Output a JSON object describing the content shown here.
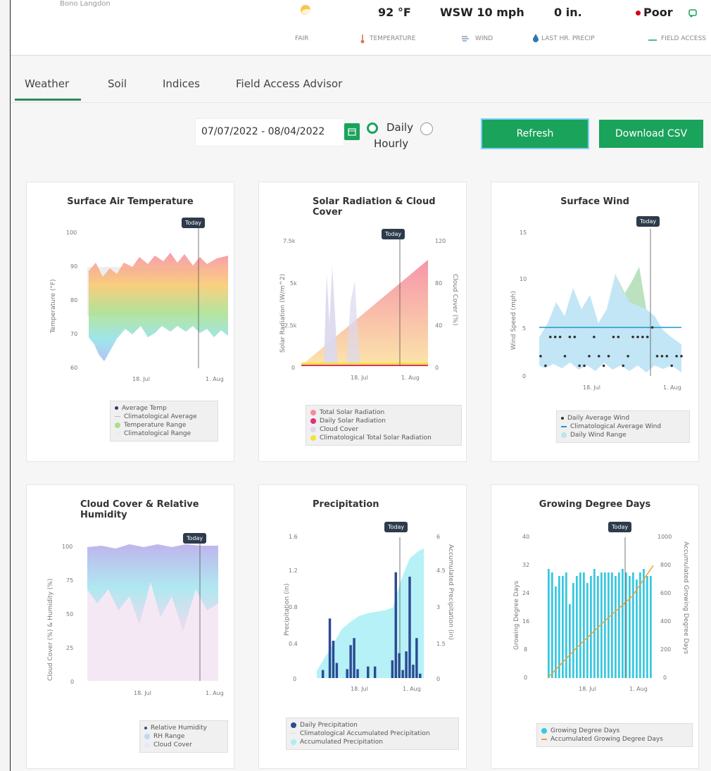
{
  "header": {
    "location": "Bono Langdon",
    "conditions": {
      "label": "FAIR"
    },
    "temperature": {
      "value": "92 °F",
      "label": "TEMPERATURE"
    },
    "wind": {
      "value": "WSW 10 mph",
      "label": "WIND"
    },
    "precip": {
      "value": "0 in.",
      "label": "LAST HR. PRECIP"
    },
    "field_access": {
      "value": "Poor",
      "label": "FIELD ACCESS",
      "status_color": "#d0021b"
    }
  },
  "tabs": [
    {
      "label": "Weather",
      "active": true
    },
    {
      "label": "Soil"
    },
    {
      "label": "Indices"
    },
    {
      "label": "Field Access Advisor"
    }
  ],
  "controls": {
    "date_range": "07/07/2022 - 08/04/2022",
    "daily_label": "Daily",
    "hourly_label": "Hourly",
    "refresh_label": "Refresh",
    "download_label": "Download CSV",
    "accent_color": "#1aa35b"
  },
  "today_label": "Today",
  "chart_data": [
    {
      "type": "area",
      "title": "Surface Air Temperature",
      "ylabel": "Temperature (°F)",
      "ylim": [
        60,
        100
      ],
      "yticks": [
        "100",
        "90",
        "80",
        "70",
        "60"
      ],
      "xticks": [
        "18. Jul",
        "1. Aug"
      ],
      "legend": [
        "Average Temp",
        "Climatological Average",
        "Temperature Range",
        "Climatological Range"
      ]
    },
    {
      "type": "area",
      "title": "Solar Radiation & Cloud Cover",
      "ylabel": "Solar Radiation (W/m^2)",
      "y2label": "Cloud Cover (%)",
      "yticks": [
        "7.5k",
        "5k",
        "2.5k",
        "0"
      ],
      "y2ticks": [
        "120",
        "80",
        "40",
        "0"
      ],
      "xticks": [
        "18. Jul",
        "1. Aug"
      ],
      "legend": [
        "Total Solar Radiation",
        "Daily Solar Radiation",
        "Cloud Cover",
        "Climatological Total Solar Radiation"
      ]
    },
    {
      "type": "scatter",
      "title": "Surface Wind",
      "ylabel": "Wind Speed (mph)",
      "ylim": [
        0,
        15
      ],
      "yticks": [
        "15",
        "10",
        "5",
        "0"
      ],
      "xticks": [
        "18. Jul",
        "1. Aug"
      ],
      "values": [
        2,
        1,
        4,
        4,
        4,
        2,
        4,
        4,
        1,
        1,
        2,
        4,
        2,
        1,
        2,
        4,
        4,
        1,
        2,
        4,
        4,
        4,
        4,
        5,
        2,
        2,
        2,
        1,
        2,
        2
      ],
      "climatological_average": 5,
      "legend": [
        "Daily Average Wind",
        "Climatological Average Wind",
        "Daily Wind Range"
      ]
    },
    {
      "type": "area",
      "title": "Cloud Cover & Relative Humidity",
      "ylabel": "Cloud Cover (%) & Humidity (%)",
      "ylim": [
        0,
        100
      ],
      "yticks": [
        "100",
        "75",
        "50",
        "25",
        "0"
      ],
      "xticks": [
        "18. Jul",
        "1. Aug"
      ],
      "legend": [
        "Relative Humidity",
        "RH Range",
        "Cloud Cover"
      ]
    },
    {
      "type": "bar",
      "title": "Precipitation",
      "ylabel": "Precipitation (in)",
      "y2label": "Accumulated Precipitation (in)",
      "ylim": [
        0,
        1.6
      ],
      "yticks": [
        "1.6",
        "1.2",
        "0.8",
        "0.4",
        "0"
      ],
      "y2ticks": [
        "6",
        "4.5",
        "3",
        "1.5",
        "0"
      ],
      "xticks": [
        "18. Jul",
        "1. Aug"
      ],
      "values": [
        0,
        0.09,
        0,
        0.67,
        0.42,
        0.17,
        0,
        0,
        0.1,
        0.37,
        0.45,
        0.1,
        0,
        0,
        0.13,
        0,
        0.13,
        0,
        0,
        0,
        0,
        0.2,
        1.19,
        0.28,
        0.09,
        0.3,
        1.14,
        0.15,
        0.45,
        0.05
      ],
      "legend": [
        "Daily Precipitation",
        "Climatological Accumulated Precipitation",
        "Accumulated Precipitation"
      ]
    },
    {
      "type": "bar",
      "title": "Growing Degree Days",
      "ylabel": "Growing Degree Days",
      "y2label": "Accumulated Growing Degree Days",
      "ylim": [
        0,
        40
      ],
      "yticks": [
        "40",
        "32",
        "24",
        "16",
        "8",
        "0"
      ],
      "y2ticks": [
        "1000",
        "800",
        "600",
        "400",
        "200",
        "0"
      ],
      "xticks": [
        "18. Jul",
        "1. Aug"
      ],
      "values": [
        31,
        30,
        26,
        29,
        29,
        30,
        21,
        27,
        29,
        30,
        30,
        27,
        29,
        31,
        29,
        30,
        30,
        30,
        30,
        29,
        30,
        31,
        30,
        29,
        30,
        28,
        30,
        31,
        29,
        29
      ],
      "legend": [
        "Growing Degree Days",
        "Accumulated Growing Degree Days"
      ]
    }
  ]
}
